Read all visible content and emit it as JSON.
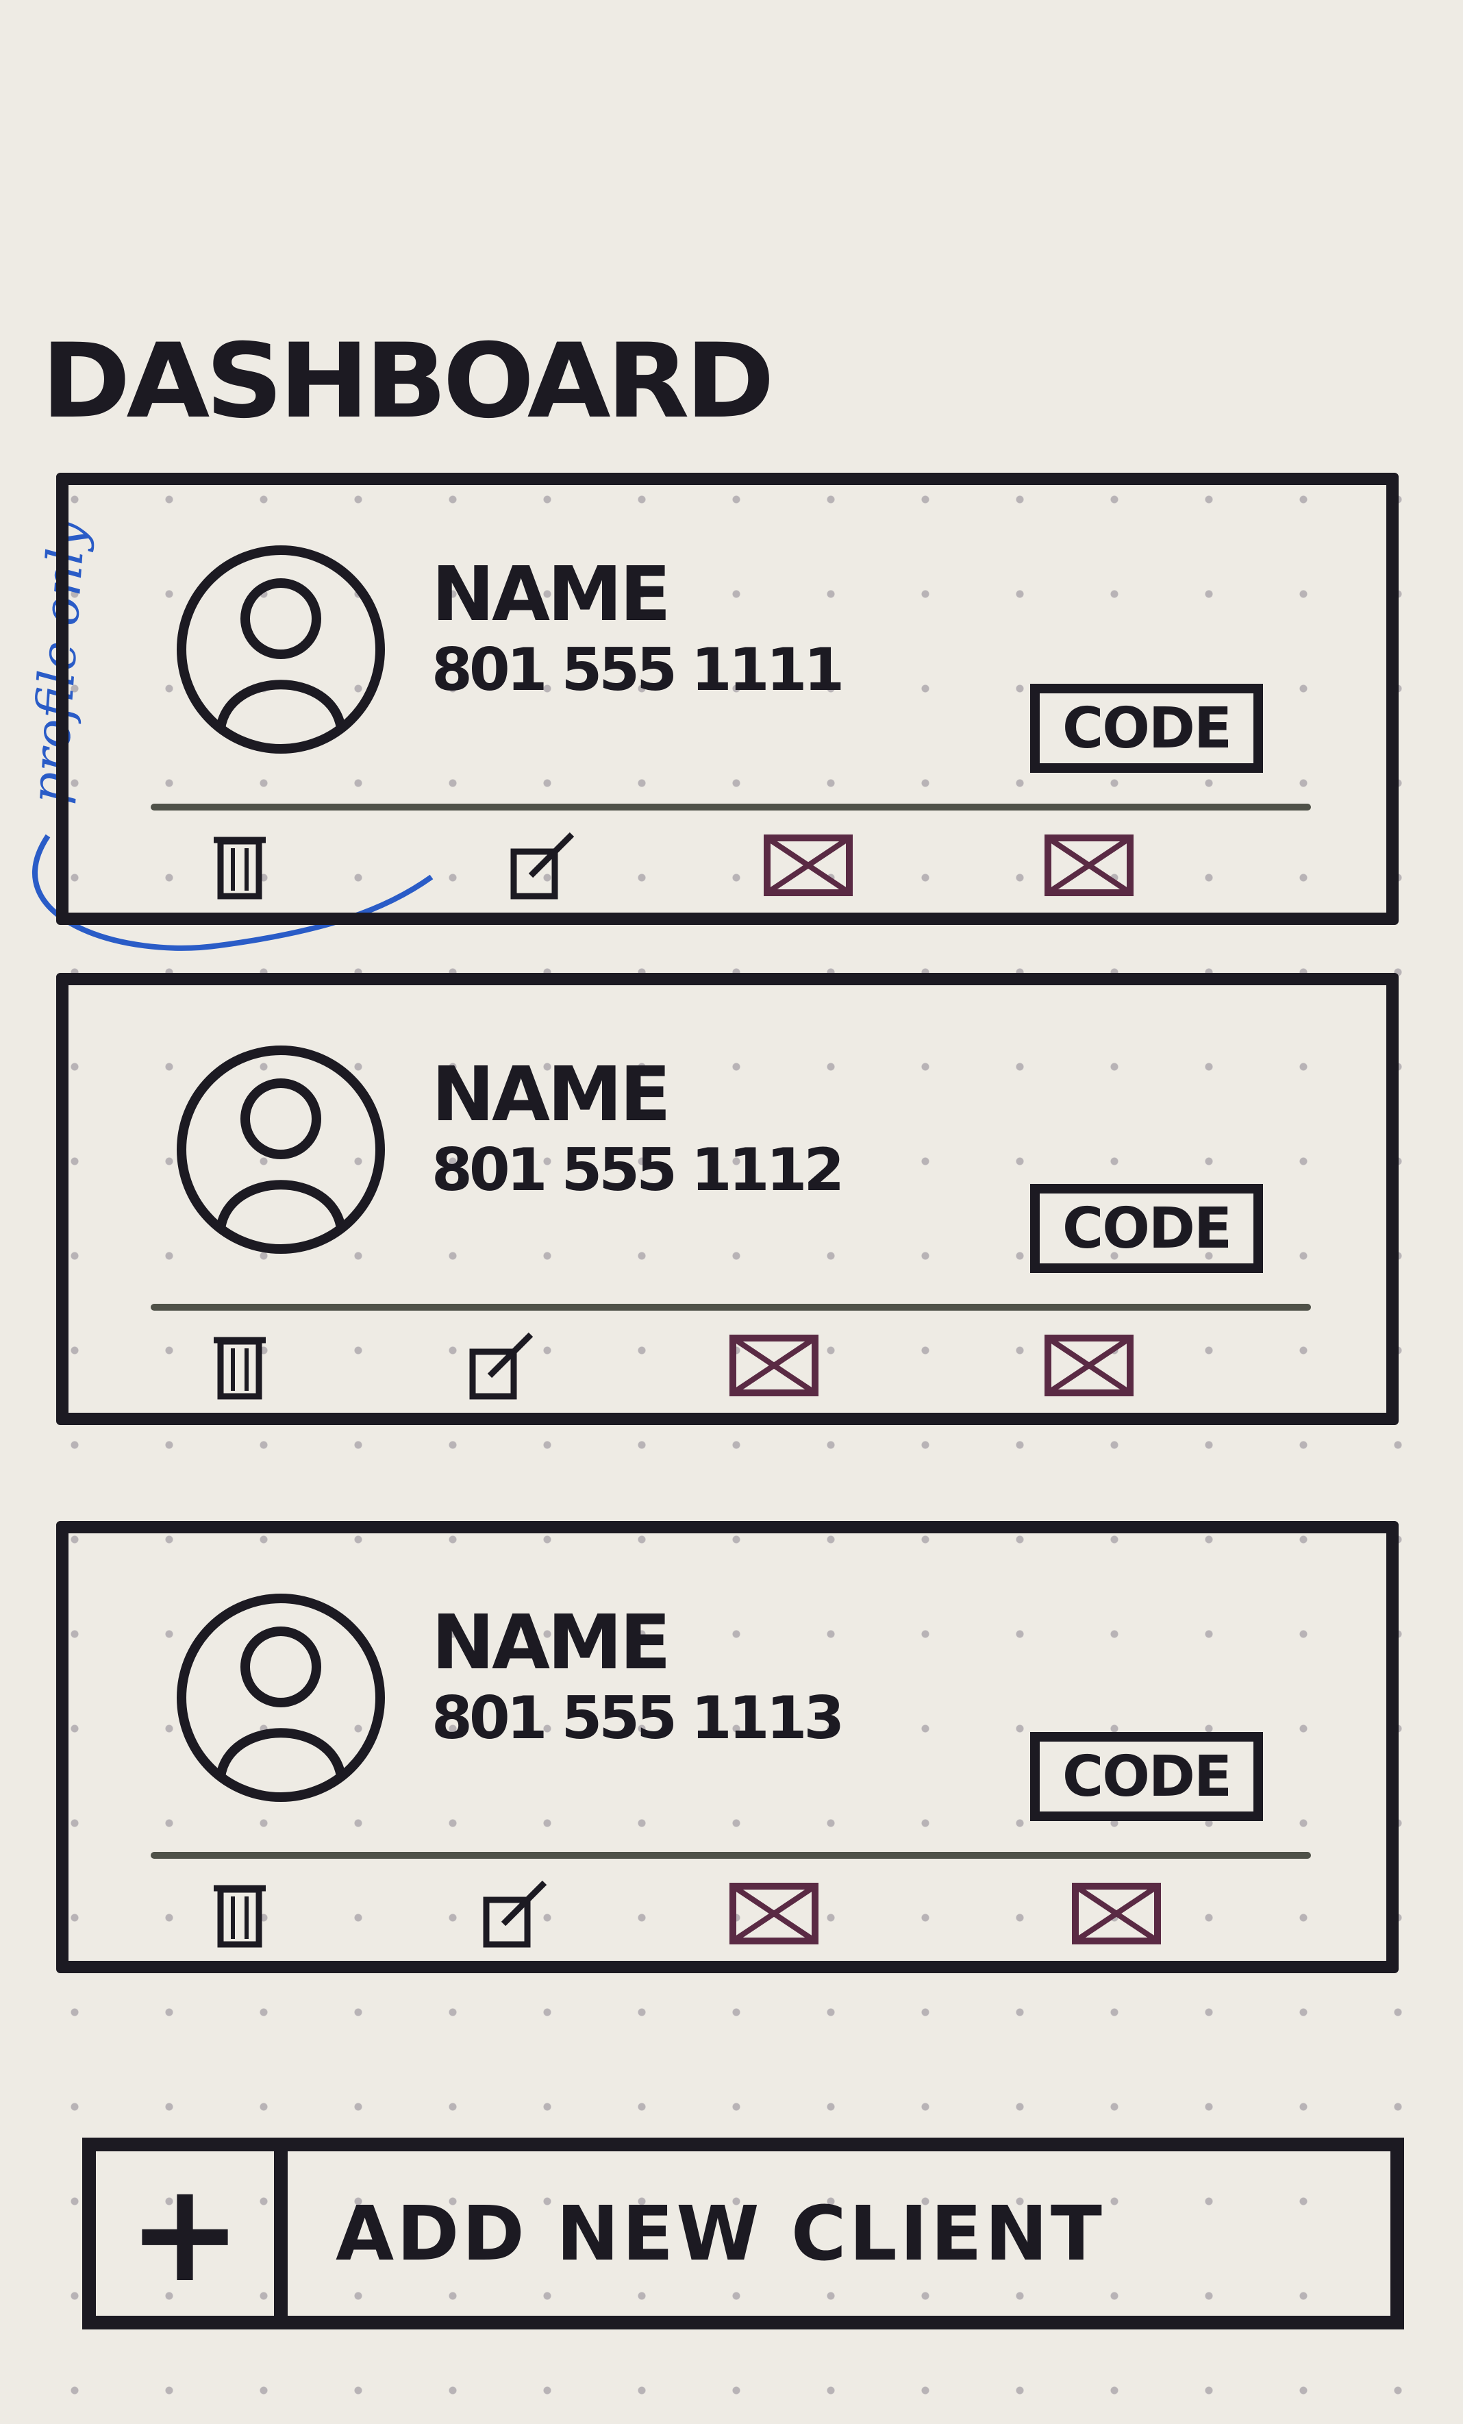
{
  "page": {
    "title": "DASHBOARD"
  },
  "annotation": {
    "text": "profile only"
  },
  "clients": [
    {
      "name": "NAME",
      "phone": "801 555 1111",
      "code_label": "CODE"
    },
    {
      "name": "NAME",
      "phone": "801 555 1112",
      "code_label": "CODE"
    },
    {
      "name": "NAME",
      "phone": "801 555 1113",
      "code_label": "CODE"
    }
  ],
  "actions": [
    "trash-icon",
    "edit-icon",
    "mail-icon",
    "message-icon"
  ],
  "add_client": {
    "icon": "+",
    "label": "ADD NEW CLIENT"
  },
  "colors": {
    "ink": "#1c1a22",
    "mail": "#5a2a44",
    "note": "#2a5cc7",
    "paper": "#eeebe4"
  }
}
